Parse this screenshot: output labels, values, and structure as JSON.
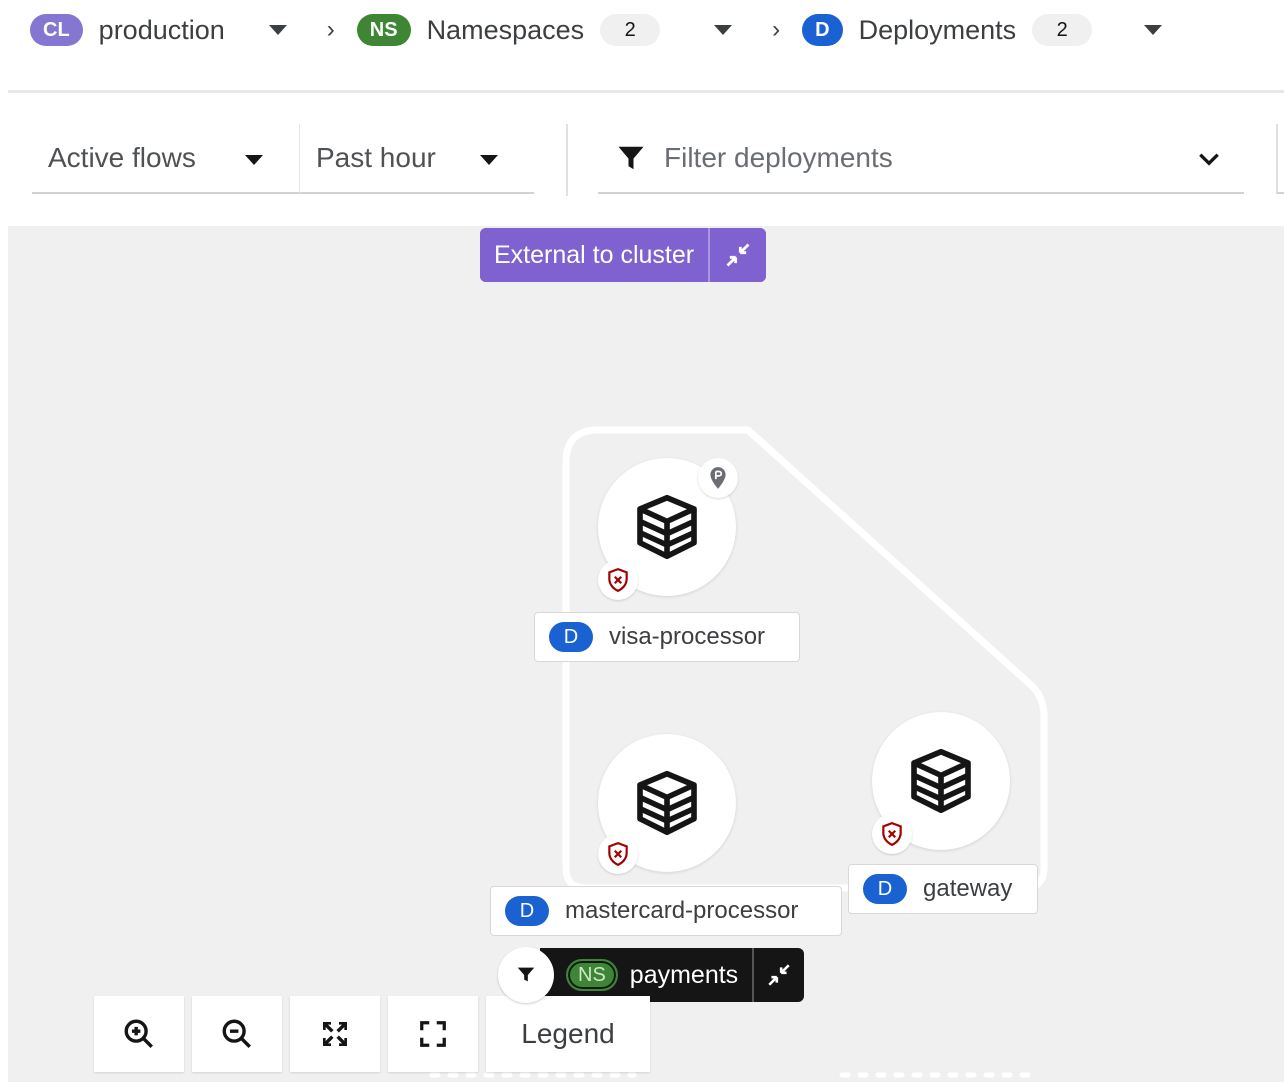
{
  "breadcrumb": {
    "cluster": {
      "badge": "CL",
      "label": "production"
    },
    "namespaces": {
      "badge": "NS",
      "label": "Namespaces",
      "count": "2"
    },
    "deployments": {
      "badge": "D",
      "label": "Deployments",
      "count": "2"
    },
    "separator": "›"
  },
  "toolbar": {
    "flows_select": "Active flows",
    "time_select": "Past hour",
    "filter_placeholder": "Filter deployments"
  },
  "graph": {
    "external_group_label": "External to cluster",
    "namespace_group": {
      "badge": "NS",
      "label": "payments"
    },
    "nodes": [
      {
        "badge": "D",
        "label": "visa-processor"
      },
      {
        "badge": "D",
        "label": "mastercard-processor"
      },
      {
        "badge": "D",
        "label": "gateway"
      }
    ]
  },
  "controls": {
    "legend_label": "Legend"
  },
  "colors": {
    "cluster_badge": "#8476d1",
    "namespace_badge": "#3e8635",
    "deployment_badge": "#1a62d2",
    "external_group": "#7f62d0",
    "shield_icon": "#a30000",
    "canvas_bg": "#f0f0f0"
  }
}
